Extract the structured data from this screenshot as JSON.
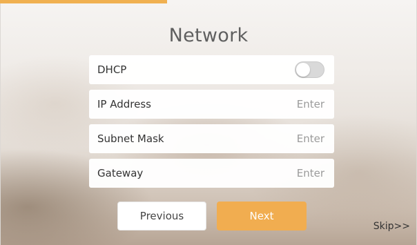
{
  "progress": {
    "value": 0.4,
    "color": "#f0b050"
  },
  "page": {
    "title": "Network"
  },
  "fields": [
    {
      "label": "DHCP",
      "type": "toggle",
      "value": "off"
    },
    {
      "label": "IP Address",
      "type": "input",
      "placeholder": "Enter"
    },
    {
      "label": "Subnet Mask",
      "type": "input",
      "placeholder": "Enter"
    },
    {
      "label": "Gateway",
      "type": "input",
      "placeholder": "Enter"
    }
  ],
  "buttons": {
    "previous_label": "Previous",
    "next_label": "Next",
    "skip_label": "Skip>>"
  },
  "colors": {
    "accent": "#f1ad50"
  }
}
